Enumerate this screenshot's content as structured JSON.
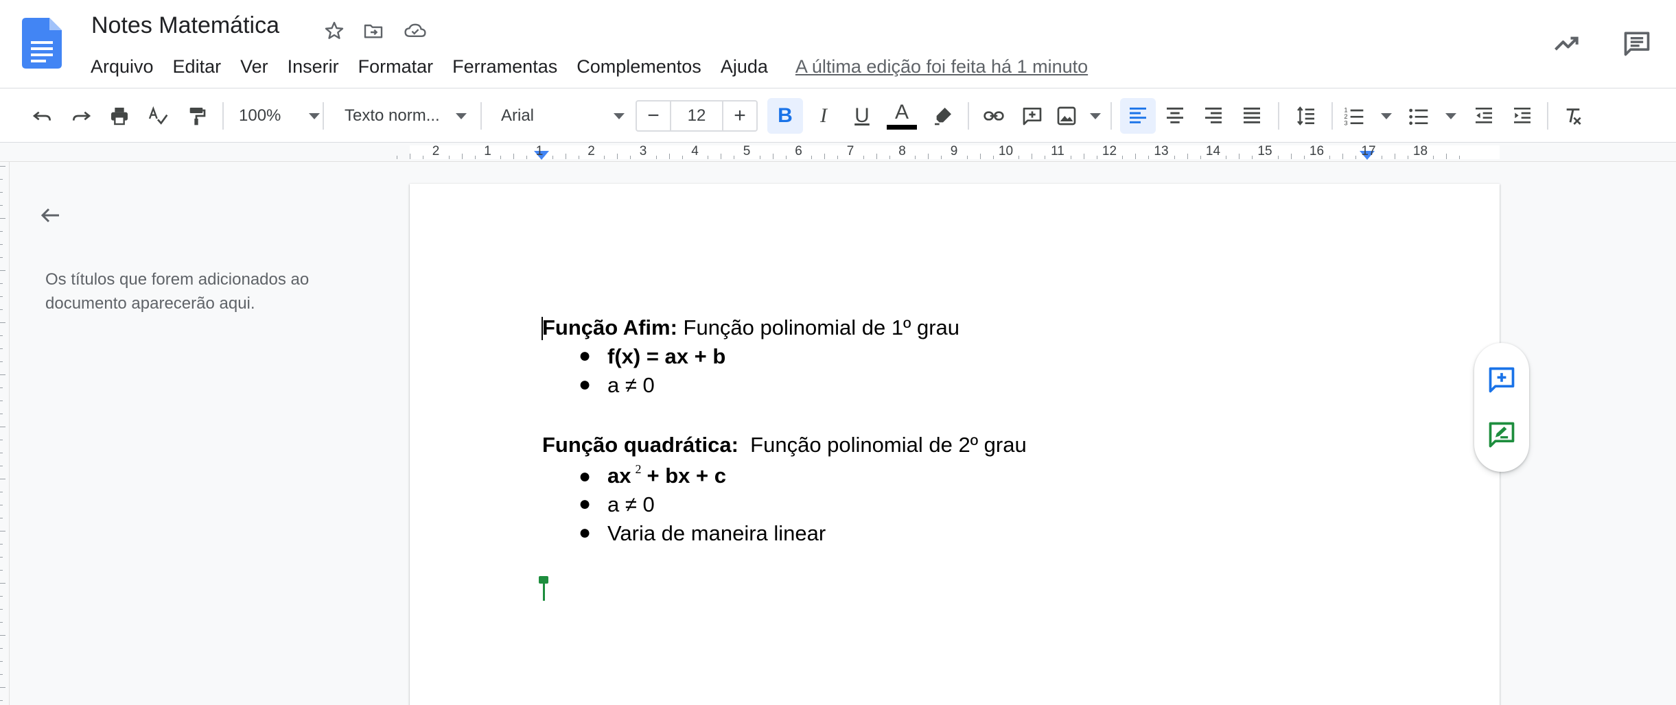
{
  "header": {
    "title": "Notes Matemática",
    "menu": [
      "Arquivo",
      "Editar",
      "Ver",
      "Inserir",
      "Formatar",
      "Ferramentas",
      "Complementos",
      "Ajuda"
    ],
    "last_edit": "A última edição foi feita há 1 minuto",
    "icons": [
      "star-icon",
      "move-to-folder-icon",
      "cloud-status-icon",
      "activity-trend-icon",
      "comments-icon"
    ]
  },
  "toolbar": {
    "zoom": "100%",
    "style": "Texto norm...",
    "font": "Arial",
    "font_size": "12",
    "decrease_label": "−",
    "increase_label": "+",
    "accent_color": "#1a73e8",
    "active": [
      "bold",
      "align-left"
    ]
  },
  "ruler": {
    "numbers": [
      "2",
      "1",
      "1",
      "2",
      "3",
      "4",
      "5",
      "6",
      "7",
      "8",
      "9",
      "10",
      "11",
      "12",
      "13",
      "14",
      "15",
      "16",
      "17",
      "18"
    ]
  },
  "outline": {
    "hint": "Os títulos que forem adicionados ao documento aparecerão aqui."
  },
  "document": {
    "h1_bold": "Função Afim:",
    "h1_rest": " Função polinomial de 1º grau",
    "list1": [
      "f(x) = ax + b",
      "a ≠ 0"
    ],
    "h2_bold": "Função quadrática:",
    "h2_rest": "  Função polinomial de 2º grau",
    "list2_item1_a": "ax",
    "list2_item1_sup": "2",
    "list2_item1_b": "+ bx + c",
    "list2_rest": [
      "a ≠ 0",
      "Varia de maneira linear"
    ],
    "bullet": "●"
  },
  "side_actions": [
    "add-comment-icon",
    "suggest-edit-icon"
  ]
}
